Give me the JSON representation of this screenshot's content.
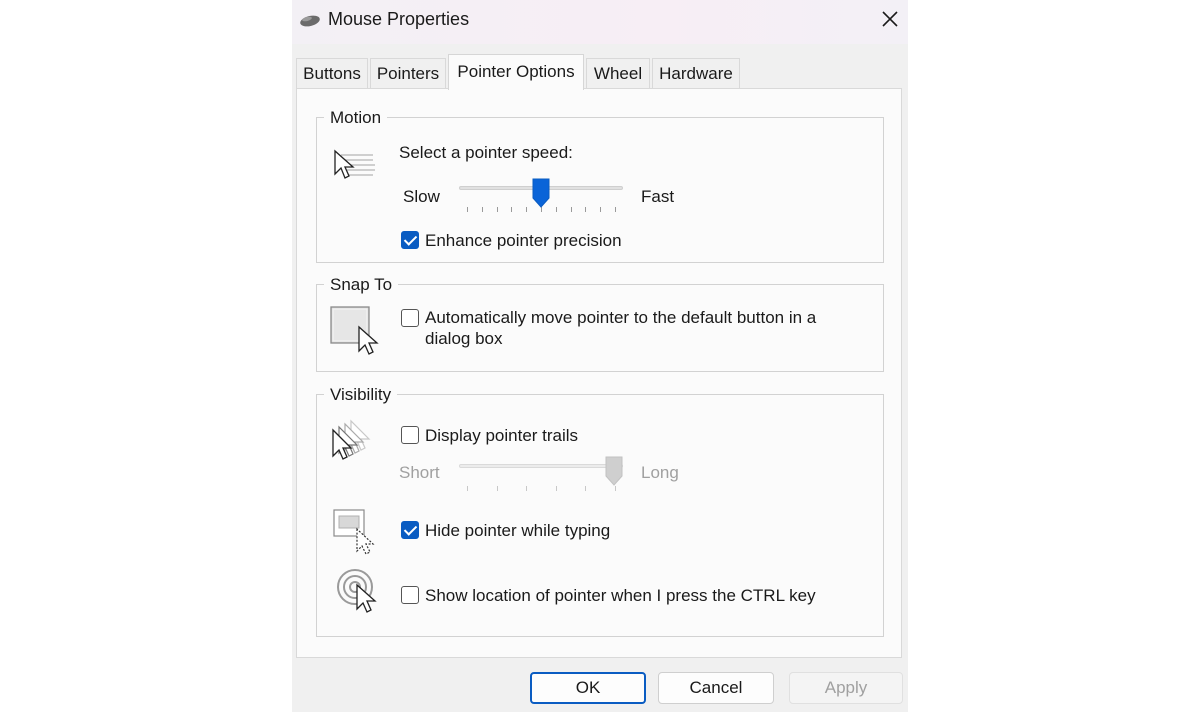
{
  "window": {
    "title": "Mouse Properties",
    "icon": "mouse-icon"
  },
  "tabs": [
    {
      "label": "Buttons",
      "active": false
    },
    {
      "label": "Pointers",
      "active": false
    },
    {
      "label": "Pointer Options",
      "active": true
    },
    {
      "label": "Wheel",
      "active": false
    },
    {
      "label": "Hardware",
      "active": false
    }
  ],
  "motion": {
    "legend": "Motion",
    "speed_label": "Select a pointer speed:",
    "slow_label": "Slow",
    "fast_label": "Fast",
    "speed_value": 0.5,
    "enhance_label": "Enhance pointer precision",
    "enhance_checked": true
  },
  "snap_to": {
    "legend": "Snap To",
    "auto_label": "Automatically move pointer to the default button in a dialog box",
    "auto_checked": false
  },
  "visibility": {
    "legend": "Visibility",
    "trails_label": "Display pointer trails",
    "trails_checked": false,
    "short_label": "Short",
    "long_label": "Long",
    "trail_length_value": 1.0,
    "hide_label": "Hide pointer while typing",
    "hide_checked": true,
    "show_location_label": "Show location of pointer when I press the CTRL key",
    "show_location_checked": false
  },
  "buttons": {
    "ok": "OK",
    "cancel": "Cancel",
    "apply": "Apply"
  },
  "colors": {
    "accent": "#0a5cc2",
    "disabled_text": "#a0a0a0"
  }
}
